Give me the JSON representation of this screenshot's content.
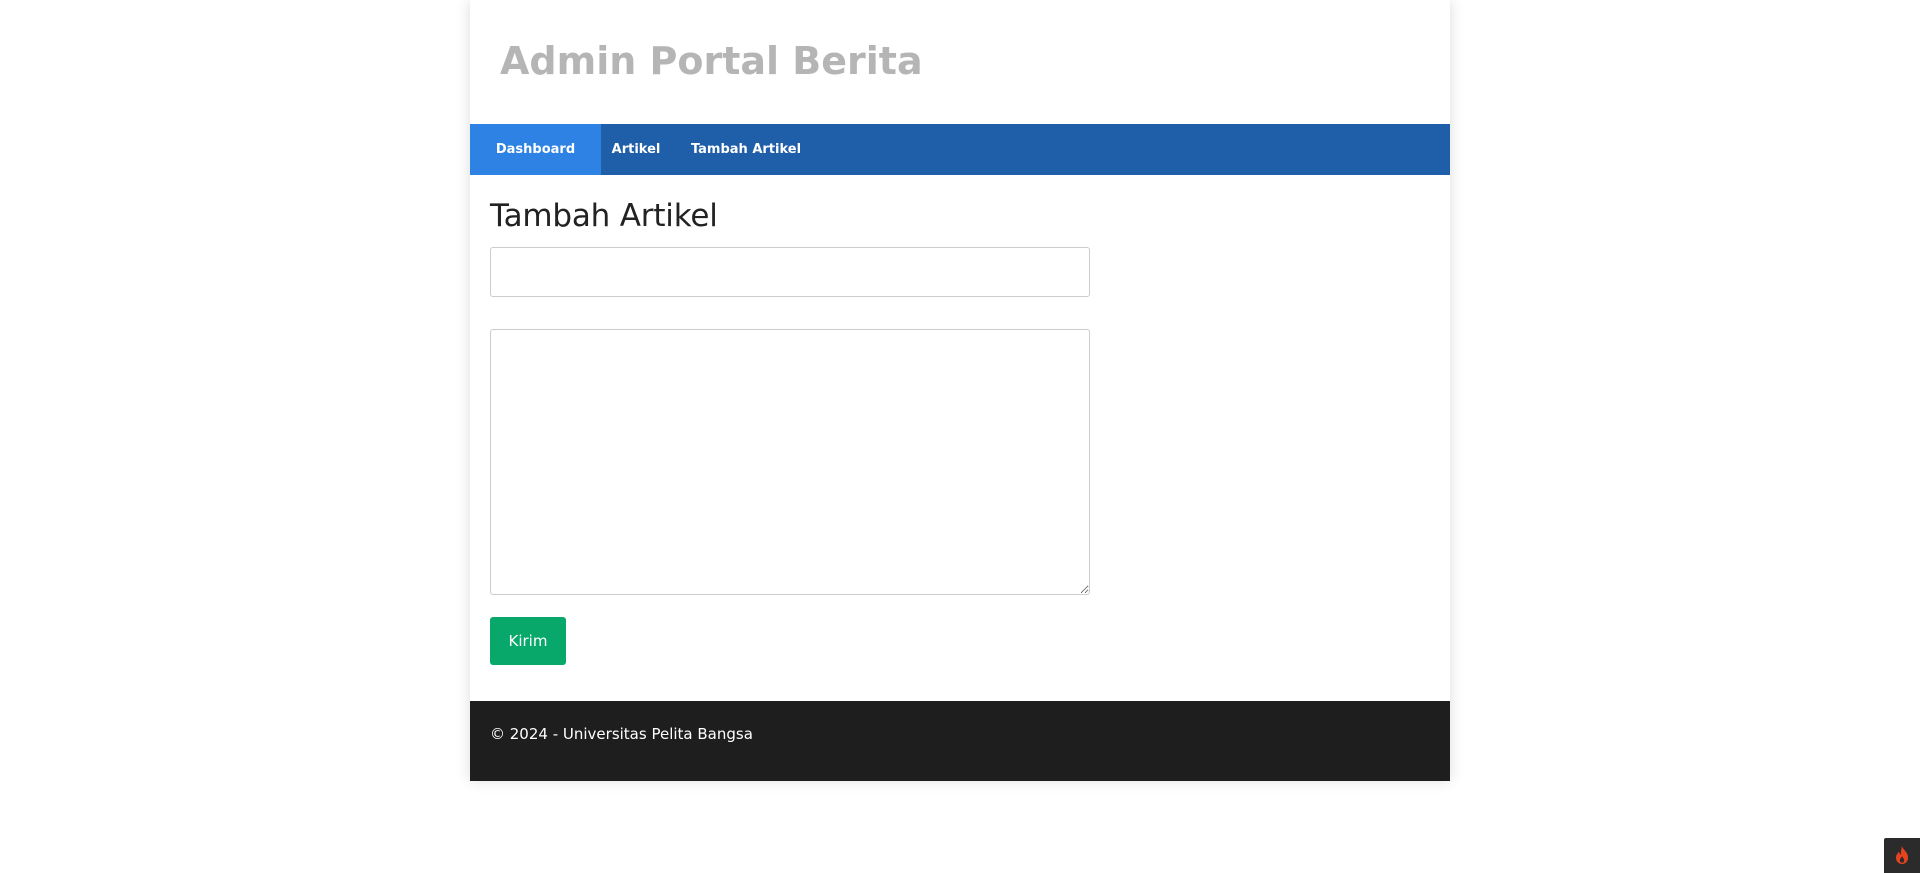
{
  "header": {
    "title": "Admin Portal Berita"
  },
  "nav": {
    "items": [
      {
        "label": "Dashboard",
        "active": true
      },
      {
        "label": "Artikel",
        "active": false
      },
      {
        "label": "Tambah Artikel",
        "active": false
      }
    ]
  },
  "main": {
    "page_title": "Tambah Artikel",
    "form": {
      "judul_value": "",
      "judul_placeholder": "",
      "isi_value": "",
      "isi_placeholder": "",
      "submit_label": "Kirim"
    }
  },
  "footer": {
    "text": "© 2024 - Universitas Pelita Bangsa"
  },
  "debug_toolbar": {
    "icon": "flame-icon"
  },
  "colors": {
    "nav_bg": "#1f5faa",
    "nav_active": "#2d82e4",
    "submit_button": "#08a86a",
    "footer_bg": "#1e1e1e",
    "title_color": "#b5b5b5",
    "flame": "#e8431f"
  }
}
